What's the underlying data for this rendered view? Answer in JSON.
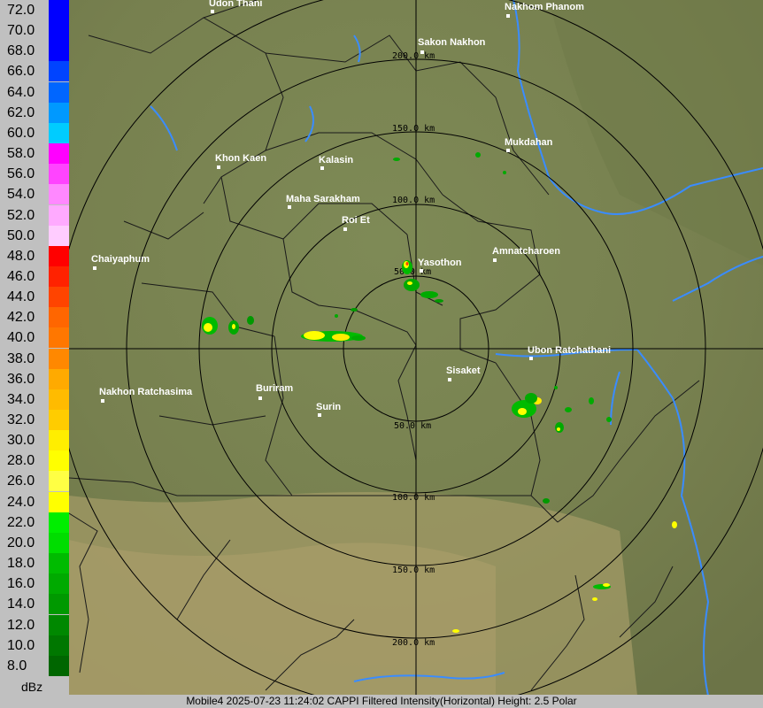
{
  "legend": {
    "unit": "dBz",
    "entries": [
      {
        "label": "72.0",
        "color": "#0000ff"
      },
      {
        "label": "70.0",
        "color": "#0000ff"
      },
      {
        "label": "68.0",
        "color": "#0000ff"
      },
      {
        "label": "66.0",
        "color": "#0044ff"
      },
      {
        "label": "64.0",
        "color": "#0066ff"
      },
      {
        "label": "62.0",
        "color": "#0099ff"
      },
      {
        "label": "60.0",
        "color": "#00ccff"
      },
      {
        "label": "58.0",
        "color": "#ff00ff"
      },
      {
        "label": "56.0",
        "color": "#ff44ff"
      },
      {
        "label": "54.0",
        "color": "#ff88ff"
      },
      {
        "label": "52.0",
        "color": "#ffaaff"
      },
      {
        "label": "50.0",
        "color": "#ffccff"
      },
      {
        "label": "48.0",
        "color": "#ff0000"
      },
      {
        "label": "46.0",
        "color": "#ff2200"
      },
      {
        "label": "44.0",
        "color": "#ff4400"
      },
      {
        "label": "42.0",
        "color": "#ff6600"
      },
      {
        "label": "40.0",
        "color": "#ff7700"
      },
      {
        "label": "38.0",
        "color": "#ff8800"
      },
      {
        "label": "36.0",
        "color": "#ffaa00"
      },
      {
        "label": "34.0",
        "color": "#ffbb00"
      },
      {
        "label": "32.0",
        "color": "#ffcc00"
      },
      {
        "label": "30.0",
        "color": "#ffee00"
      },
      {
        "label": "28.0",
        "color": "#ffff00"
      },
      {
        "label": "26.0",
        "color": "#ffff44"
      },
      {
        "label": "24.0",
        "color": "#ffff00"
      },
      {
        "label": "22.0",
        "color": "#00ee00"
      },
      {
        "label": "20.0",
        "color": "#00dd00"
      },
      {
        "label": "18.0",
        "color": "#00bb00"
      },
      {
        "label": "16.0",
        "color": "#00aa00"
      },
      {
        "label": "14.0",
        "color": "#009900"
      },
      {
        "label": "12.0",
        "color": "#008800"
      },
      {
        "label": "10.0",
        "color": "#007700"
      },
      {
        "label": "8.0",
        "color": "#006600"
      }
    ]
  },
  "rings": [
    {
      "label": "50.0 km"
    },
    {
      "label": "100.0 km"
    },
    {
      "label": "150.0 km"
    },
    {
      "label": "200.0 km"
    }
  ],
  "cities": [
    {
      "name": "Udon Thani"
    },
    {
      "name": "Nakhom Phanom"
    },
    {
      "name": "Sakon Nakhon"
    },
    {
      "name": "Mukdahan"
    },
    {
      "name": "Khon Kaen"
    },
    {
      "name": "Kalasin"
    },
    {
      "name": "Maha Sarakham"
    },
    {
      "name": "Roi Et"
    },
    {
      "name": "Chaiyaphum"
    },
    {
      "name": "Yasothon"
    },
    {
      "name": "Amnatcharoen"
    },
    {
      "name": "Ubon Ratchathani"
    },
    {
      "name": "Sisaket"
    },
    {
      "name": "Nakhon Ratchasima"
    },
    {
      "name": "Buriram"
    },
    {
      "name": "Surin"
    }
  ],
  "colors": {
    "terrain": "#7d8754",
    "terrain_light": "#9a9160",
    "ring": "#000000",
    "border": "#1a1a1a",
    "water": "#3a8cff",
    "label": "#ffffff"
  },
  "status": {
    "text": "Mobile4 2025-07-23 11:24:02 CAPPI Filtered Intensity(Horizontal)  Height: 2.5 Polar"
  }
}
